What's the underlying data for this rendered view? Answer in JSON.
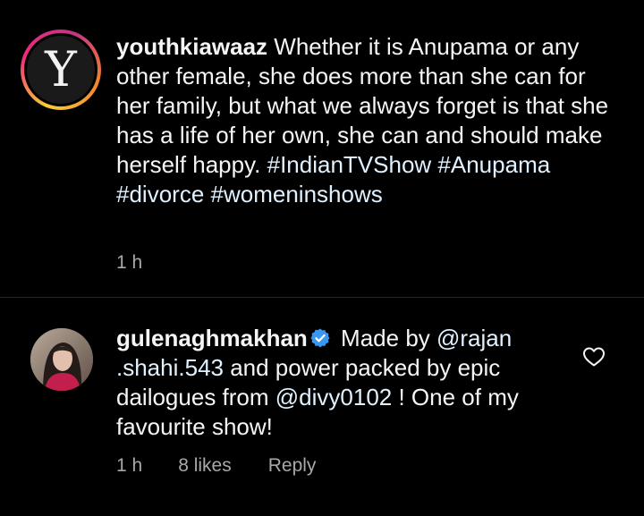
{
  "caption": {
    "username": "youthkiawaaz",
    "avatar_letter": "Y",
    "text": " Whether it is Anupama or any other female, she does more than she can for her family, but what we always forget is that she has a life of her own, she can and should make herself happy. ",
    "hashtags": [
      "#IndianTVShow",
      "#Anupama",
      "#divorce",
      "#womeninshows"
    ],
    "time": "1 h"
  },
  "reply": {
    "username": "gulenaghmakhan",
    "verified_icon": "verified-badge-icon",
    "text_before": " Made by ",
    "mention1": "@rajan .shahi.543",
    "text_middle": "  and power packed by epic dailogues from ",
    "mention2": "@divy0102",
    "text_after": " ! One of my favourite show!",
    "time": "1 h",
    "likes": "8 likes",
    "reply_label": "Reply",
    "like_icon": "heart-outline-icon"
  },
  "colors": {
    "background": "#000000",
    "text": "#f5f5f5",
    "meta": "#a8a8a8",
    "mention": "#e0f1ff",
    "verified": "#3897f0"
  }
}
